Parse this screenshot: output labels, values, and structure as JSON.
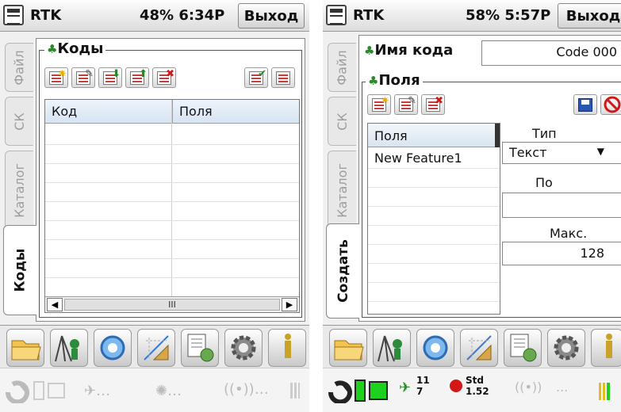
{
  "left_screen": {
    "app_name": "RTK",
    "status": "48% 6:34P",
    "exit_label": "Выход",
    "tabs": [
      "Файл",
      "СК",
      "Каталог",
      "Коды"
    ],
    "group_title": "Коды",
    "table": {
      "columns": [
        "Код",
        "Поля"
      ],
      "scroll_thumb": "III"
    }
  },
  "right_screen": {
    "app_name": "RTK",
    "status": "58% 5:57P",
    "exit_label": "Выход",
    "tabs": [
      "Файл",
      "СК",
      "Каталог",
      "Создать"
    ],
    "code_name_label": "Имя кода",
    "code_name_value": "Code 000",
    "fields_title": "Поля",
    "fields_list": {
      "header": "Поля",
      "items": [
        "New Feature1"
      ]
    },
    "value_type_label": "Тип значения",
    "value_type_selected": "Текст",
    "default_label": "По умолчанию",
    "default_value": "",
    "max_length_label": "Макс. длина",
    "max_length_value": "128"
  },
  "status_bar": {
    "satellites_top": "11",
    "satellites_bottom": "7",
    "solution": "Std",
    "precision": "1.52",
    "ellipsis": "..."
  },
  "colors": {
    "accent_blue": "#1f4fa8",
    "battery_green": "#1fd11f"
  }
}
